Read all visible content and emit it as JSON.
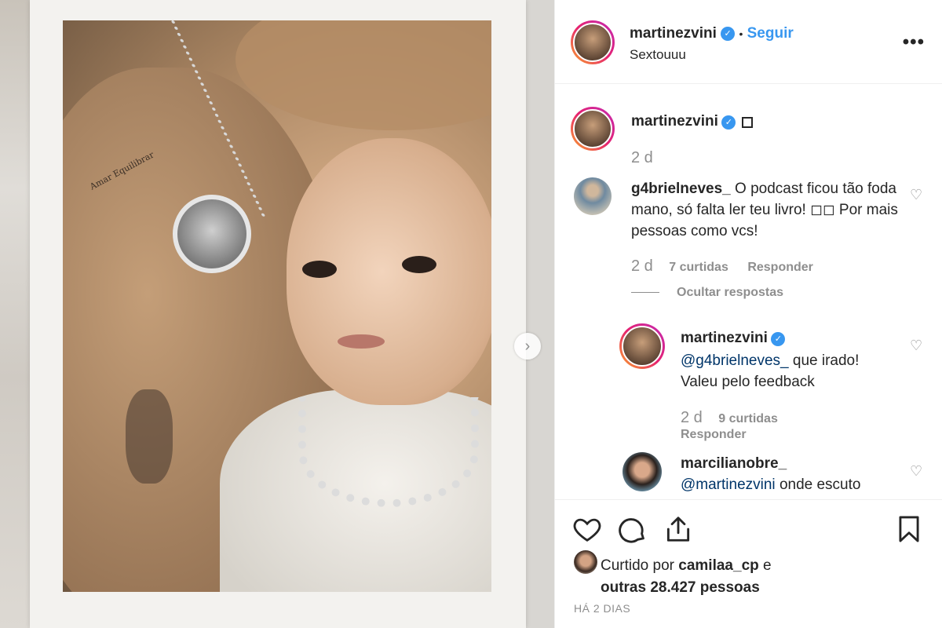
{
  "post": {
    "author": "martinezvini",
    "follow_label": "Seguir",
    "separator": "•",
    "caption": "Sextouuu",
    "more_label": "•••"
  },
  "media": {
    "tattoo_text": "Amar Equilibrar",
    "next_label": "›"
  },
  "caption_comment": {
    "username": "martinezvini",
    "age": "2 d"
  },
  "comments": [
    {
      "username": "g4brielneves_",
      "text": "O podcast ficou tão foda mano, só falta ler teu livro! ◻◻ Por mais pessoas como vcs!",
      "age": "2 d",
      "likes": "7 curtidas",
      "reply_label": "Responder",
      "hide_replies": "Ocultar respostas"
    }
  ],
  "replies": [
    {
      "username": "martinezvini",
      "mention": "@g4brielneves_",
      "text": "que irado! Valeu pelo feedback",
      "age": "2 d",
      "likes": "9 curtidas",
      "reply_label": "Responder"
    },
    {
      "username": "marcilianobre_",
      "mention": "@martinezvini",
      "text": "onde escuto"
    }
  ],
  "footer": {
    "liked_prefix": "Curtido por",
    "liked_user": "camilaa_cp",
    "liked_and": "e",
    "liked_others": "outras 28.427 pessoas",
    "time_ago": "HÁ 2 DIAS"
  },
  "icons": {
    "verified": "verified-badge-icon",
    "like": "heart-icon",
    "comment": "comment-bubble-icon",
    "share": "share-icon",
    "save": "bookmark-icon"
  },
  "colors": {
    "link_blue": "#3897f0",
    "mention_blue": "#003569",
    "muted": "#8e8e8e"
  }
}
